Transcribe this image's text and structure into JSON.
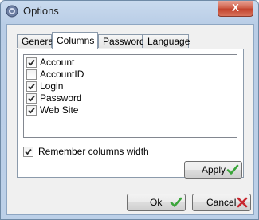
{
  "window": {
    "title": "Options",
    "close_glyph": "X"
  },
  "tabs": [
    {
      "label": "General"
    },
    {
      "label": "Columns"
    },
    {
      "label": "Password"
    },
    {
      "label": "Language"
    }
  ],
  "active_tab": "Columns",
  "columns": [
    {
      "label": "Account",
      "checked": true
    },
    {
      "label": "AccountID",
      "checked": false
    },
    {
      "label": "Login",
      "checked": true
    },
    {
      "label": "Password",
      "checked": true
    },
    {
      "label": "Web Site",
      "checked": true
    }
  ],
  "remember": {
    "label": "Remember columns width",
    "checked": true
  },
  "buttons": {
    "apply": "Apply",
    "ok": "Ok",
    "cancel": "Cancel"
  },
  "colors": {
    "check_green": "#3aa53a",
    "cancel_red": "#c8262e",
    "checkmark": "#2b2b2b"
  },
  "icons": {
    "title": "gear-icon",
    "apply": "green-check-icon",
    "ok": "green-check-icon",
    "cancel": "red-x-icon"
  }
}
